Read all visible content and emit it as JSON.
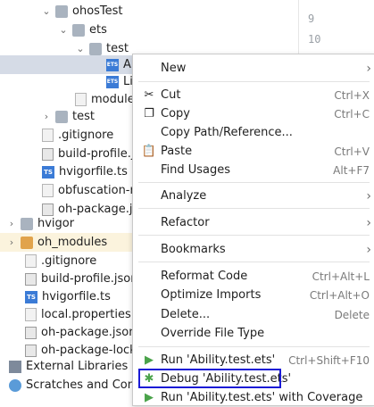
{
  "editor": {
    "line_numbers": [
      "9",
      "10"
    ]
  },
  "tree": [
    {
      "label": "ohosTest",
      "kind": "folder",
      "expanded": true
    },
    {
      "label": "ets",
      "kind": "folder",
      "expanded": true
    },
    {
      "label": "test",
      "kind": "folder",
      "expanded": true
    },
    {
      "label": "A",
      "kind": "ets"
    },
    {
      "label": "Li",
      "kind": "ets"
    },
    {
      "label": "module",
      "kind": "file"
    },
    {
      "label": "test",
      "kind": "folder",
      "expanded": false
    },
    {
      "label": ".gitignore",
      "kind": "file"
    },
    {
      "label": "build-profile.js",
      "kind": "json"
    },
    {
      "label": "hvigorfile.ts",
      "kind": "ts"
    },
    {
      "label": "obfuscation-ru",
      "kind": "file"
    },
    {
      "label": "oh-package.js",
      "kind": "json"
    },
    {
      "label": "hvigor",
      "kind": "folder",
      "expanded": false
    },
    {
      "label": "oh_modules",
      "kind": "folder",
      "expanded": false
    },
    {
      "label": ".gitignore",
      "kind": "file"
    },
    {
      "label": "build-profile.json",
      "kind": "json"
    },
    {
      "label": "hvigorfile.ts",
      "kind": "ts"
    },
    {
      "label": "local.properties",
      "kind": "file"
    },
    {
      "label": "oh-package.json",
      "kind": "json"
    },
    {
      "label": "oh-package-lock",
      "kind": "json"
    },
    {
      "label": "External Libraries",
      "kind": "libs"
    },
    {
      "label": "Scratches and Conso",
      "kind": "scratch"
    }
  ],
  "menu": {
    "new": "New",
    "cut": "Cut",
    "cut_sc": "Ctrl+X",
    "copy": "Copy",
    "copy_sc": "Ctrl+C",
    "copy_path": "Copy Path/Reference...",
    "paste": "Paste",
    "paste_sc": "Ctrl+V",
    "find_usages": "Find Usages",
    "find_usages_sc": "Alt+F7",
    "analyze": "Analyze",
    "refactor": "Refactor",
    "bookmarks": "Bookmarks",
    "reformat": "Reformat Code",
    "reformat_sc": "Ctrl+Alt+L",
    "optimize": "Optimize Imports",
    "optimize_sc": "Ctrl+Alt+O",
    "delete": "Delete...",
    "delete_sc": "Delete",
    "override": "Override File Type",
    "run": "Run 'Ability.test.ets'",
    "run_sc": "Ctrl+Shift+F10",
    "debug": "Debug 'Ability.test.ets'",
    "coverage": "Run 'Ability.test.ets' with Coverage"
  },
  "colors": {
    "selection": "#d5dbe6",
    "highlight_row": "#fbf3dd",
    "focus_box": "#1a1ad6",
    "run_green": "#4aa34a"
  }
}
